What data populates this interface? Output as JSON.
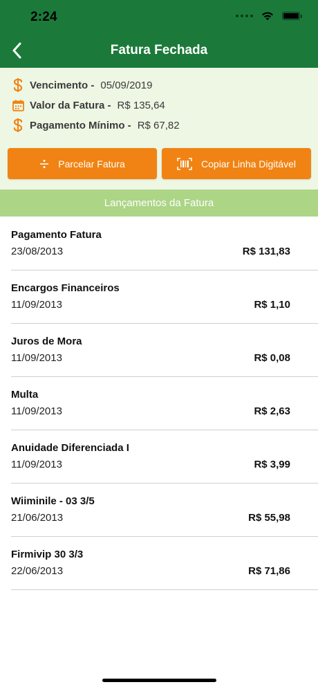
{
  "status_bar": {
    "time": "2:24"
  },
  "header": {
    "title": "Fatura Fechada",
    "back_icon": "chevron-left-icon"
  },
  "colors": {
    "header_green": "#1b7a3a",
    "summary_bg": "#eef6e4",
    "accent_orange": "#f08313",
    "section_green": "#acd586"
  },
  "summary": {
    "due": {
      "label": "Vencimento -",
      "value": "05/09/2019",
      "icon": "dollar-icon"
    },
    "total": {
      "label": "Valor da Fatura -",
      "value": "R$ 135,64",
      "icon": "calendar-icon"
    },
    "minimum": {
      "label": "Pagamento Mínimo -",
      "value": "R$ 67,82",
      "icon": "dollar-icon"
    }
  },
  "actions": {
    "installments": {
      "label": "Parcelar Fatura",
      "icon": "divide-icon"
    },
    "copy_barcode": {
      "label": "Copiar Linha Digitável",
      "icon": "barcode-icon"
    }
  },
  "section": {
    "title": "Lançamentos da Fatura"
  },
  "transactions": [
    {
      "title": "Pagamento Fatura",
      "date": "23/08/2013",
      "amount": "R$ 131,83"
    },
    {
      "title": "Encargos Financeiros",
      "date": "11/09/2013",
      "amount": "R$ 1,10"
    },
    {
      "title": "Juros de Mora",
      "date": "11/09/2013",
      "amount": "R$ 0,08"
    },
    {
      "title": "Multa",
      "date": "11/09/2013",
      "amount": "R$ 2,63"
    },
    {
      "title": "Anuidade Diferenciada I",
      "date": "11/09/2013",
      "amount": "R$ 3,99"
    },
    {
      "title": "Wiiminile - 03 3/5",
      "date": "21/06/2013",
      "amount": "R$ 55,98"
    },
    {
      "title": "Firmivip 30 3/3",
      "date": "22/06/2013",
      "amount": "R$ 71,86"
    }
  ]
}
